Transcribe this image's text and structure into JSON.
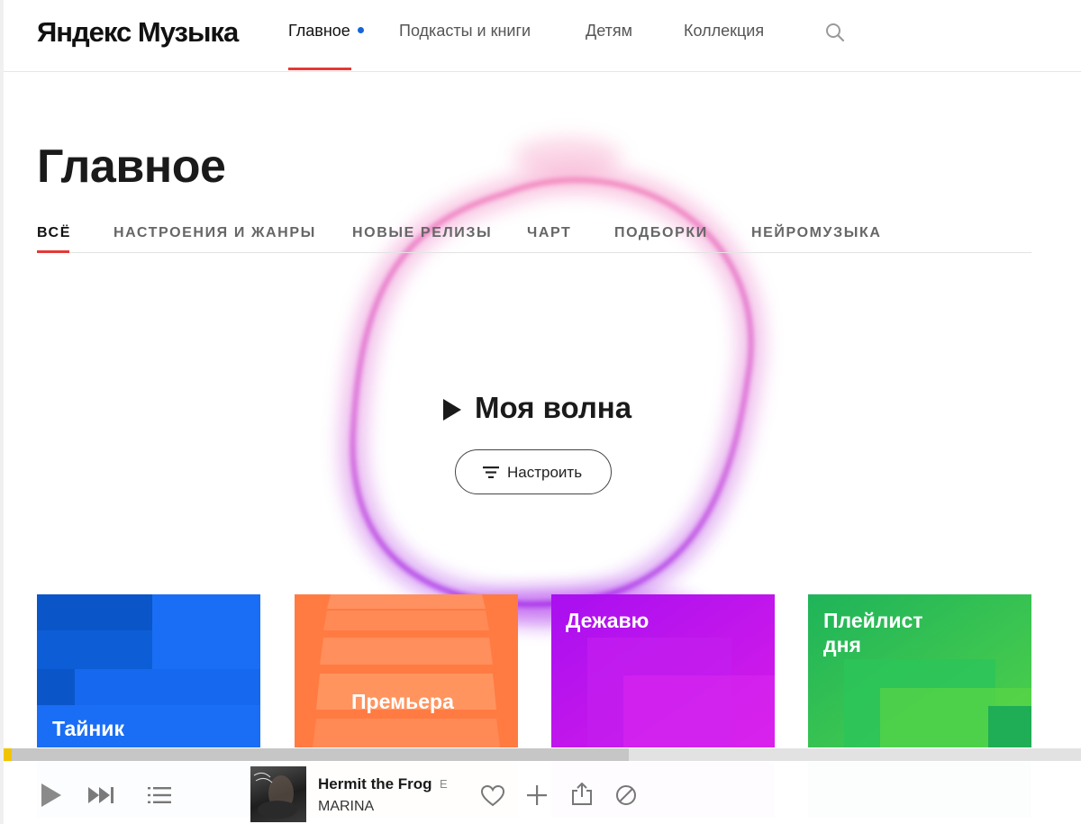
{
  "header": {
    "logo": "Яндекс Музыка",
    "nav": [
      {
        "label": "Главное",
        "active": true
      },
      {
        "label": "Подкасты и книги"
      },
      {
        "label": "Детям"
      },
      {
        "label": "Коллекция"
      }
    ],
    "search_icon": "search-icon"
  },
  "page": {
    "title": "Главное",
    "tabs": [
      {
        "label": "ВСЁ",
        "active": true
      },
      {
        "label": "НАСТРОЕНИЯ И ЖАНРЫ"
      },
      {
        "label": "НОВЫЕ РЕЛИЗЫ"
      },
      {
        "label": "ЧАРТ"
      },
      {
        "label": "ПОДБОРКИ"
      },
      {
        "label": "НЕЙРОМУЗЫКА"
      }
    ]
  },
  "wave": {
    "title": "Моя волна",
    "tune_label": "Настроить",
    "play_icon": "play-icon",
    "tune_icon": "filter-icon"
  },
  "cards": [
    {
      "label": "Тайник",
      "color": "#1666e8"
    },
    {
      "label": "Премьера",
      "color": "#ff7a3d"
    },
    {
      "label": "Дежавю",
      "color": "#b515f2"
    },
    {
      "label": "Плейлист дня",
      "color": "#2dbf5c"
    }
  ],
  "player": {
    "progress": 0.58,
    "track_title": "Hermit the Frog",
    "explicit": "E",
    "artist": "MARINA",
    "icons": [
      "play-icon",
      "next-icon",
      "queue-icon",
      "heart-icon",
      "add-icon",
      "share-icon",
      "block-icon"
    ]
  }
}
